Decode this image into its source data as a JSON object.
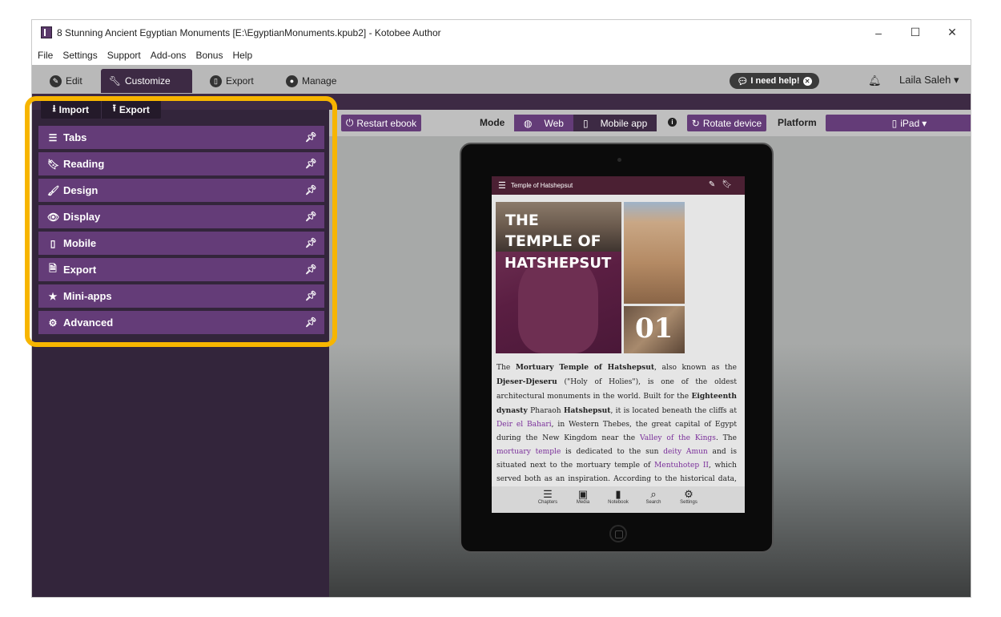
{
  "titlebar": {
    "title": "8 Stunning Ancient Egyptian Monuments [E:\\EgyptianMonuments.kpub2] - Kotobee Author",
    "minimize": "–",
    "maximize": "☐",
    "close": "✕"
  },
  "menubar": {
    "items": [
      "File",
      "Settings",
      "Support",
      "Add-ons",
      "Bonus",
      "Help"
    ]
  },
  "topnav": {
    "tabs": [
      {
        "label": "Edit",
        "icon": "pencil-icon"
      },
      {
        "label": "Customize",
        "icon": "wrench-icon"
      },
      {
        "label": "Export",
        "icon": "export-icon"
      },
      {
        "label": "Manage",
        "icon": "user-icon"
      }
    ],
    "active_tab": "Customize",
    "help_label": "I need help!",
    "user_name": "Laila Saleh"
  },
  "sidebar": {
    "import_label": "Import",
    "export_label": "Export",
    "items": [
      {
        "label": "Tabs",
        "icon": "list-icon"
      },
      {
        "label": "Reading",
        "icon": "bookmark-icon"
      },
      {
        "label": "Design",
        "icon": "brush-icon"
      },
      {
        "label": "Display",
        "icon": "eye-icon"
      },
      {
        "label": "Mobile",
        "icon": "mobile-icon"
      },
      {
        "label": "Export",
        "icon": "pdf-icon"
      },
      {
        "label": "Mini-apps",
        "icon": "star-icon"
      },
      {
        "label": "Advanced",
        "icon": "gear-icon"
      }
    ],
    "highlight_color": "#f7b500"
  },
  "toolbar": {
    "restart_label": "Restart ebook",
    "mode_label": "Mode",
    "mode_web": "Web",
    "mode_mobile": "Mobile app",
    "info_label": "i",
    "rotate_label": "Rotate device",
    "platform_label": "Platform",
    "platform_value": "iPad"
  },
  "ebook": {
    "header_title": "Temple of Hatshepsut",
    "cover_line1": "THE",
    "cover_line2": "TEMPLE OF",
    "cover_line3": "HATSHEPSUT",
    "chapter_number": "01",
    "footer": [
      "Chapters",
      "Media",
      "Notebook",
      "Search",
      "Settings"
    ]
  },
  "colors": {
    "accent_purple": "#643c78",
    "dark_purple": "#3d2a44",
    "sidebar_bg": "#33253b",
    "highlight": "#f7b500"
  }
}
